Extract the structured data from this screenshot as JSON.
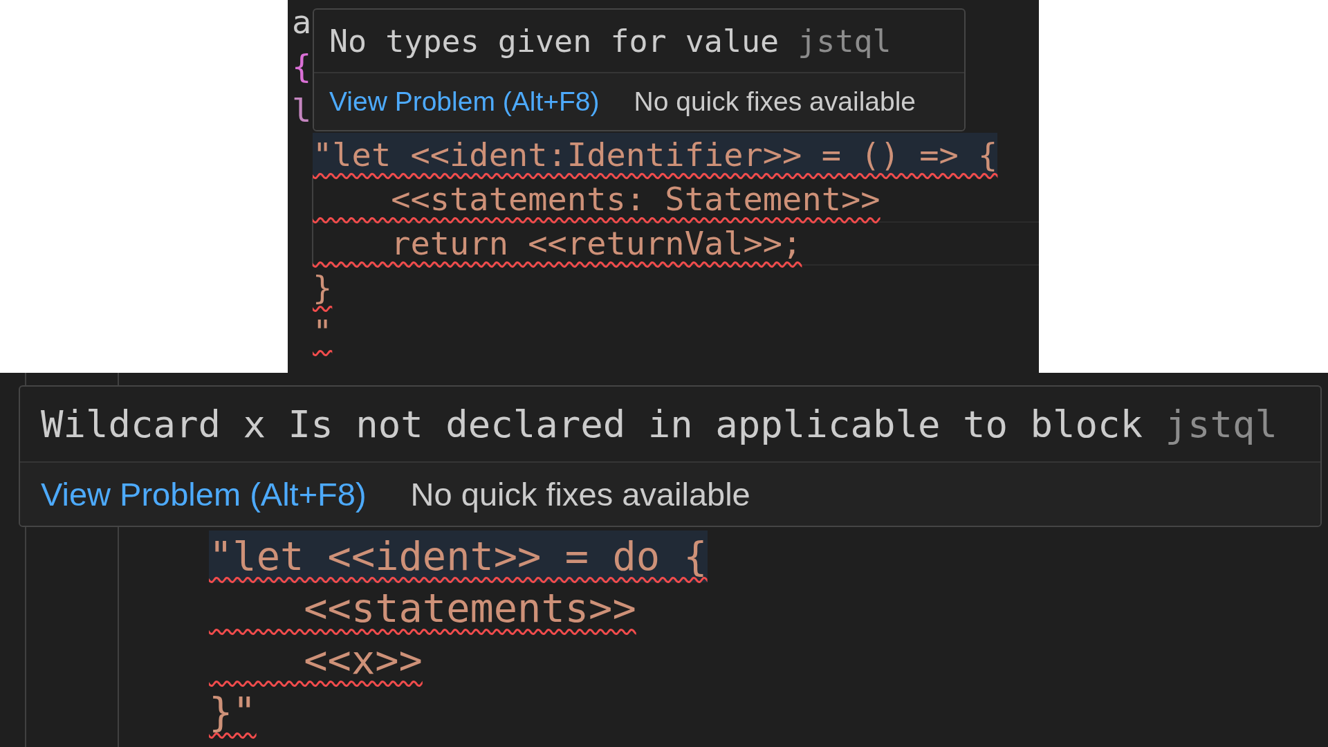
{
  "panels": [
    {
      "kind": "small",
      "fragments": [
        {
          "text": "a",
          "kind": "plain"
        },
        {
          "text": "{",
          "kind": "bracket"
        },
        {
          "text": "l",
          "kind": "keyword"
        }
      ],
      "hover": {
        "message": "No types given for value",
        "source": "jstql",
        "action": "View Problem (Alt+F8)",
        "note": "No quick fixes available"
      },
      "lines": [
        {
          "text": "\"let <<ident:Identifier>> = () => {",
          "selected": true,
          "error": true,
          "current": false
        },
        {
          "text": "    <<statements: Statement>>",
          "selected": false,
          "error": true,
          "current": false
        },
        {
          "text": "    return <<returnVal>>;",
          "selected": false,
          "error": true,
          "current": true
        },
        {
          "text": "}",
          "selected": false,
          "error": true,
          "current": false
        },
        {
          "text": "\"",
          "selected": false,
          "error": true,
          "current": false
        }
      ]
    },
    {
      "kind": "large",
      "hover": {
        "message": "Wildcard x Is not declared in applicable to block",
        "source": "jstql",
        "action": "View Problem (Alt+F8)",
        "note": "No quick fixes available"
      },
      "lines": [
        {
          "text": "\"let <<ident>> = do {",
          "selected": true,
          "error": true,
          "current": false
        },
        {
          "text": "    <<statements>>",
          "selected": false,
          "error": true,
          "current": false
        },
        {
          "text": "    <<x>>",
          "selected": false,
          "error": true,
          "current": false
        },
        {
          "text": "}\"",
          "selected": false,
          "error": true,
          "current": false
        }
      ]
    }
  ]
}
